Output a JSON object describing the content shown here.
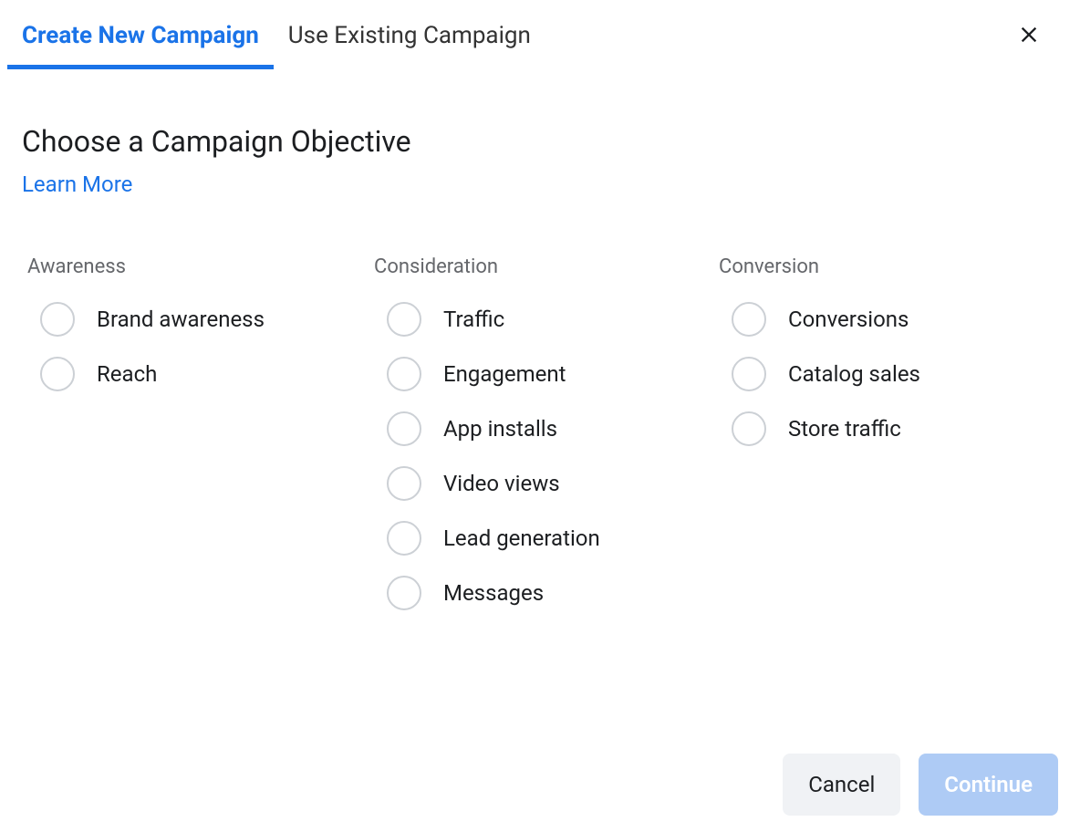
{
  "tabs": {
    "create": "Create New Campaign",
    "existing": "Use Existing Campaign"
  },
  "header": {
    "title": "Choose a Campaign Objective",
    "learn_more": "Learn More"
  },
  "columns": [
    {
      "header": "Awareness",
      "options": [
        "Brand awareness",
        "Reach"
      ]
    },
    {
      "header": "Consideration",
      "options": [
        "Traffic",
        "Engagement",
        "App installs",
        "Video views",
        "Lead generation",
        "Messages"
      ]
    },
    {
      "header": "Conversion",
      "options": [
        "Conversions",
        "Catalog sales",
        "Store traffic"
      ]
    }
  ],
  "footer": {
    "cancel": "Cancel",
    "continue": "Continue"
  }
}
